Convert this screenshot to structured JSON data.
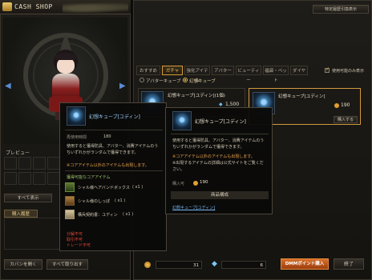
{
  "shop": {
    "title": "CASH SHOP"
  },
  "left": {
    "preview_label": "プレビュー",
    "checkbox_label": "すべて表示",
    "history_tab": "購入履歴",
    "bag_button": "カバンを開く",
    "take_all_button": "すべて取り出す"
  },
  "top": {
    "history_button": "特定履歴引換表示"
  },
  "category_tabs": [
    "おすすめ",
    "ガチャ",
    "強化アイテム",
    "アバター",
    "ビューティー",
    "福袋・ペット",
    "ダイヤ"
  ],
  "filter": {
    "show_usable_label": "使用可能のみ表示",
    "radio_avatar": "アバターキューブ",
    "radio_phantom": "幻想キューブ"
  },
  "items": [
    {
      "name": "幻想キューブ[ユディン](1個)",
      "price": "1,500"
    },
    {
      "name": "幻想キューブ[ユディン]",
      "price": "190",
      "buy_label": "購入する"
    }
  ],
  "tooltip_left": {
    "title": "幻想キューブ[ユディン]",
    "period_label": "再使用時間",
    "period_value": "180",
    "desc": "使用すると獲得防具、アバター、消費アイテムのうちいずれかがランダムで獲得できます。",
    "note": "※コアアイテム以外のアイテムも出現します。",
    "section": "獲得可能なコアアイテム",
    "rewards": [
      {
        "name": "シャル様ヘアバンドボックス",
        "qty": "( x1 )"
      },
      {
        "name": "シャル様のしっぽ",
        "qty": "( x1 )"
      },
      {
        "name": "構兵契約書：ユディン",
        "qty": "( x1 )"
      }
    ],
    "warnings": [
      "分解不可",
      "取引不可",
      "トレード不可"
    ]
  },
  "tooltip_right": {
    "title": "幻想キューブ[ユディン]",
    "desc": "使用すると獲得防具、アバター、消費アイテムのうちいずれかがランダムで獲得できます。",
    "note": "※コアアイテム以外のアイテムも出現します。",
    "note2": "※出現するアイテムの詳細は公式サイトをご覧ください。",
    "buy_label": "購入可",
    "price": "190",
    "section": "商品構成",
    "link": "幻想キューブ[ユディン]"
  },
  "bottom": {
    "coin_value": "31",
    "diamond_value": "6",
    "dmm_button": "DMMポイント購入",
    "close_button": "終了"
  }
}
